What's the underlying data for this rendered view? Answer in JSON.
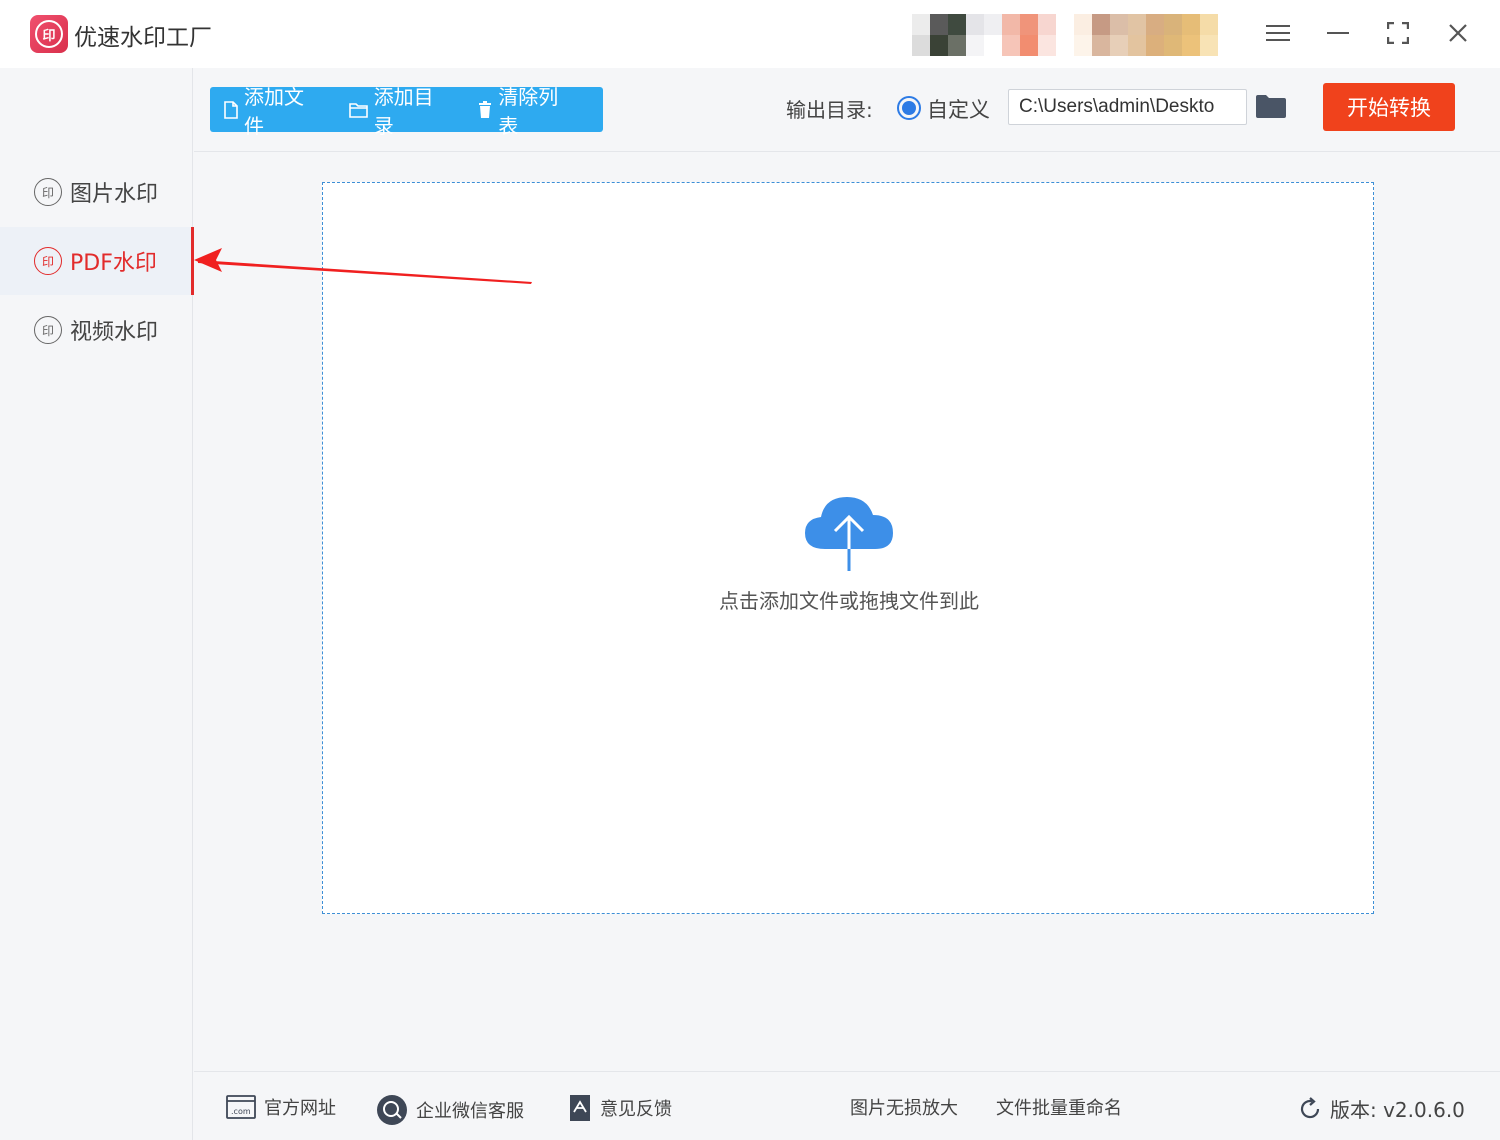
{
  "app": {
    "title": "优速水印工厂",
    "logo_text": "印"
  },
  "window": {
    "menu_icon": "hamburger-icon",
    "minimize_icon": "minimize-icon",
    "maximize_icon": "maximize-icon",
    "close_icon": "close-icon"
  },
  "sidebar": {
    "items": [
      {
        "label": "图片水印",
        "active": false
      },
      {
        "label": "PDF水印",
        "active": true
      },
      {
        "label": "视频水印",
        "active": false
      }
    ]
  },
  "toolbar": {
    "add_file": "添加文件",
    "add_dir": "添加目录",
    "clear_list": "清除列表",
    "output_label": "输出目录:",
    "custom_option": "自定义",
    "output_path": "C:\\Users\\admin\\Deskto",
    "start_button": "开始转换"
  },
  "dropzone": {
    "hint": "点击添加文件或拖拽文件到此"
  },
  "footer": {
    "website": "官方网址",
    "wechat_support": "企业微信客服",
    "feedback": "意见反馈",
    "image_upscale": "图片无损放大",
    "batch_rename": "文件批量重命名",
    "version": "版本:  v2.0.6.0"
  },
  "colors": {
    "accent_blue": "#2eaaf0",
    "start_red": "#f0421c",
    "active_red": "#e22b2b",
    "cloud_blue": "#3d8fe8"
  }
}
